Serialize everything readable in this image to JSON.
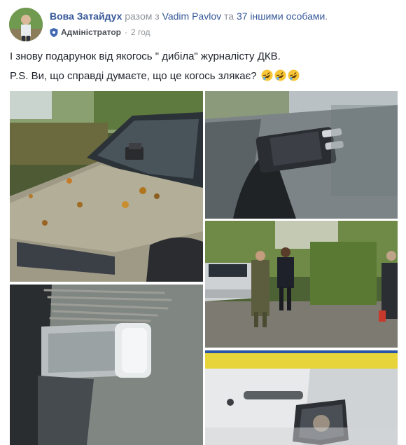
{
  "post": {
    "author": "Вова Затайдух",
    "with_text": "разом з",
    "tagged_person": "Vadim Pavlov",
    "and_text": "та",
    "others_link": "37 іншими особами",
    "ellipsis": ".",
    "role_label": "Адміністратор",
    "separator": "·",
    "time": "2 год",
    "text_line_1": "І знову подарунок від якогось \" дибіла\" журналісту ДКВ.",
    "text_line_2": "P.S. Ви, що справді думаєте, що це когось злякає?"
  },
  "icons": {
    "role_icon": "shield-icon",
    "emoji": "rolling-on-floor-laughing-emoji",
    "emoji_count": 3
  },
  "photos": [
    {
      "name": "photo-car-hood-with-device"
    },
    {
      "name": "photo-device-closeup-tape"
    },
    {
      "name": "photo-bottle-with-electrodes"
    },
    {
      "name": "photo-officials-near-car"
    },
    {
      "name": "photo-service-vehicle-door"
    }
  ],
  "colors": {
    "link": "#365899",
    "muted": "#90949c",
    "text": "#1d2129"
  }
}
